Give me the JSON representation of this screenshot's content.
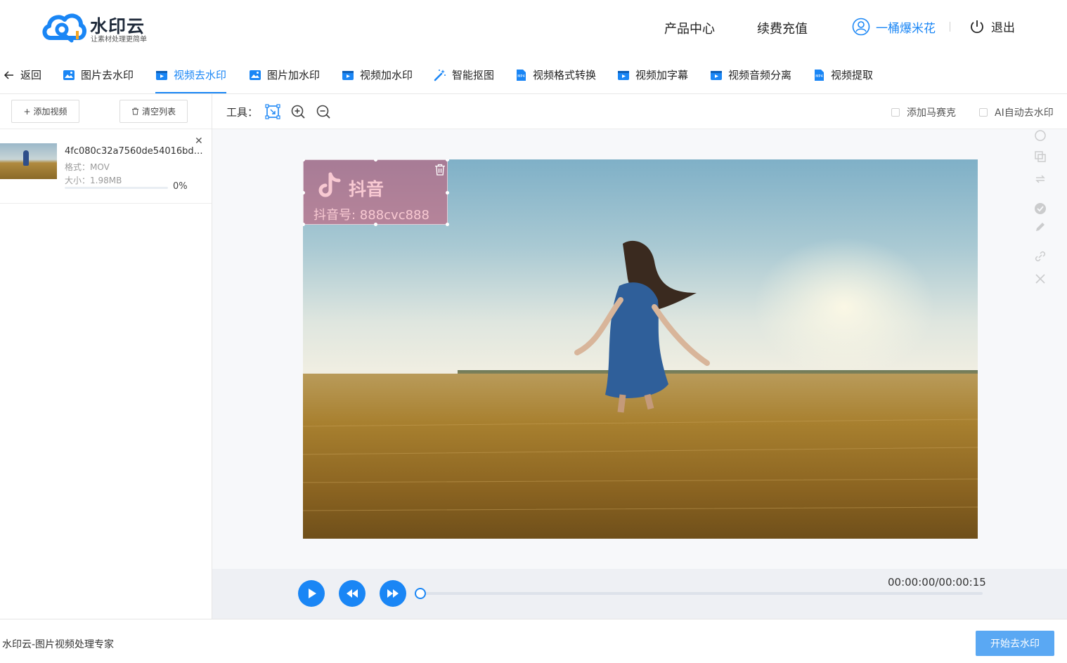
{
  "brand": {
    "title": "水印云",
    "subtitle": "让素材处理更简单",
    "primary_color": "#1a86f5"
  },
  "header": {
    "nav": [
      {
        "label": "产品中心"
      },
      {
        "label": "续费充值"
      }
    ],
    "user": {
      "name": "一桶爆米花",
      "icon": "user-circle-icon"
    },
    "logout": {
      "label": "退出",
      "icon": "power-icon"
    }
  },
  "tabs": {
    "back": {
      "label": "返回",
      "icon": "arrow-left-icon"
    },
    "items": [
      {
        "label": "图片去水印",
        "icon": "image-icon",
        "active": false
      },
      {
        "label": "视频去水印",
        "icon": "video-icon",
        "active": true
      },
      {
        "label": "图片加水印",
        "icon": "image-icon",
        "active": false
      },
      {
        "label": "视频加水印",
        "icon": "video-icon",
        "active": false
      },
      {
        "label": "智能抠图",
        "icon": "magic-wand-icon",
        "active": false
      },
      {
        "label": "视频格式转换",
        "icon": "mp4-icon",
        "active": false
      },
      {
        "label": "视频加字幕",
        "icon": "video-icon",
        "active": false
      },
      {
        "label": "视频音频分离",
        "icon": "video-icon",
        "active": false
      },
      {
        "label": "视频提取",
        "icon": "mp4-icon",
        "active": false
      }
    ]
  },
  "left_panel": {
    "add_video": "添加视频",
    "clear_list": "清空列表",
    "files": [
      {
        "name": "4fc080c32a7560de54016bd6c...",
        "format": "格式：MOV",
        "size": "大小：1.98MB",
        "progress_text": "0%",
        "progress": 0
      }
    ]
  },
  "toolbar": {
    "label": "工具：",
    "tools": [
      {
        "name": "select-area",
        "icon": "select-area-icon"
      },
      {
        "name": "zoom-in",
        "icon": "zoom-in-icon"
      },
      {
        "name": "zoom-out",
        "icon": "zoom-out-icon"
      }
    ],
    "mosaic": {
      "label": "添加马赛克",
      "checked": false
    },
    "ai_remove": {
      "label": "AI自动去水印",
      "checked": false
    }
  },
  "video": {
    "watermark": {
      "brand": "抖音",
      "account": "抖音号: 888cvc888",
      "color": "#c8506e"
    }
  },
  "player": {
    "time": "00:00:00/00:00:15",
    "progress": 0
  },
  "footer": {
    "text": "水印云-图片视频处理专家",
    "start_button": "开始去水印"
  }
}
